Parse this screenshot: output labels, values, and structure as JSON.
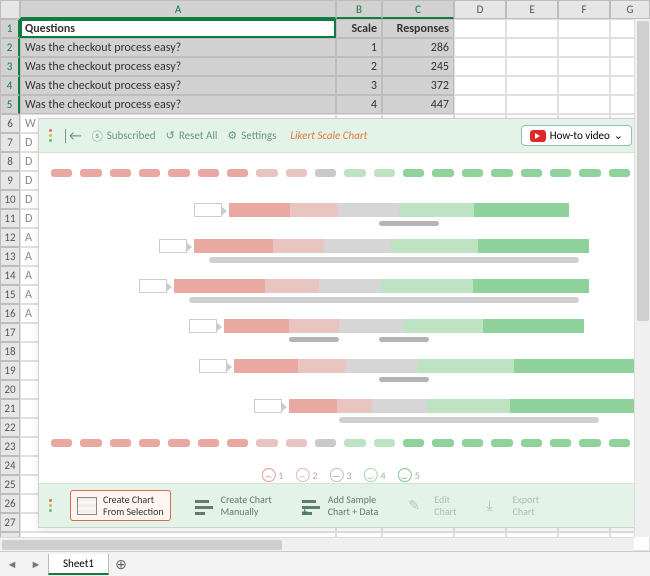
{
  "columns": [
    "A",
    "B",
    "C",
    "D",
    "E",
    "F",
    "G"
  ],
  "rows_count": 28,
  "selected_cols": [
    "A",
    "B",
    "C"
  ],
  "selected_rows": [
    1,
    2,
    3,
    4,
    5
  ],
  "active_cell": "A1",
  "headers": {
    "A": "Questions",
    "B": "Scale",
    "C": "Responses"
  },
  "data": [
    {
      "q": "Was the checkout process easy?",
      "s": "1",
      "r": "286"
    },
    {
      "q": "Was the checkout process easy?",
      "s": "2",
      "r": "245"
    },
    {
      "q": "Was the checkout process easy?",
      "s": "3",
      "r": "372"
    },
    {
      "q": "Was the checkout process easy?",
      "s": "4",
      "r": "447"
    }
  ],
  "partial_col_vals": [
    "W",
    "D",
    "D",
    "D",
    "D",
    "D",
    "A",
    "A",
    "A",
    "A",
    "A"
  ],
  "addin": {
    "subscribed": "Subscribed",
    "reset": "Reset All",
    "settings": "Settings",
    "title": "Likert Scale Chart",
    "howto": "How-to video",
    "legend": [
      "1",
      "2",
      "3",
      "4",
      "5"
    ],
    "buttons": {
      "create_sel_l1": "Create Chart",
      "create_sel_l2": "From Selection",
      "create_man_l1": "Create Chart",
      "create_man_l2": "Manually",
      "sample_l1": "Add Sample",
      "sample_l2": "Chart + Data",
      "edit_l1": "Edit",
      "edit_l2": "Chart",
      "export_l1": "Export",
      "export_l2": "Chart"
    }
  },
  "chart_data": {
    "type": "bar",
    "description": "Likert-scale preview chart (faded placeholder rows)",
    "scale": [
      1,
      2,
      3,
      4,
      5
    ],
    "colors": {
      "1": "#e9a9a2",
      "2": "#e9c5c1",
      "3": "#c9c9c9",
      "4": "#bde3c3",
      "5": "#8fd29b"
    }
  },
  "tab": {
    "name": "Sheet1"
  }
}
